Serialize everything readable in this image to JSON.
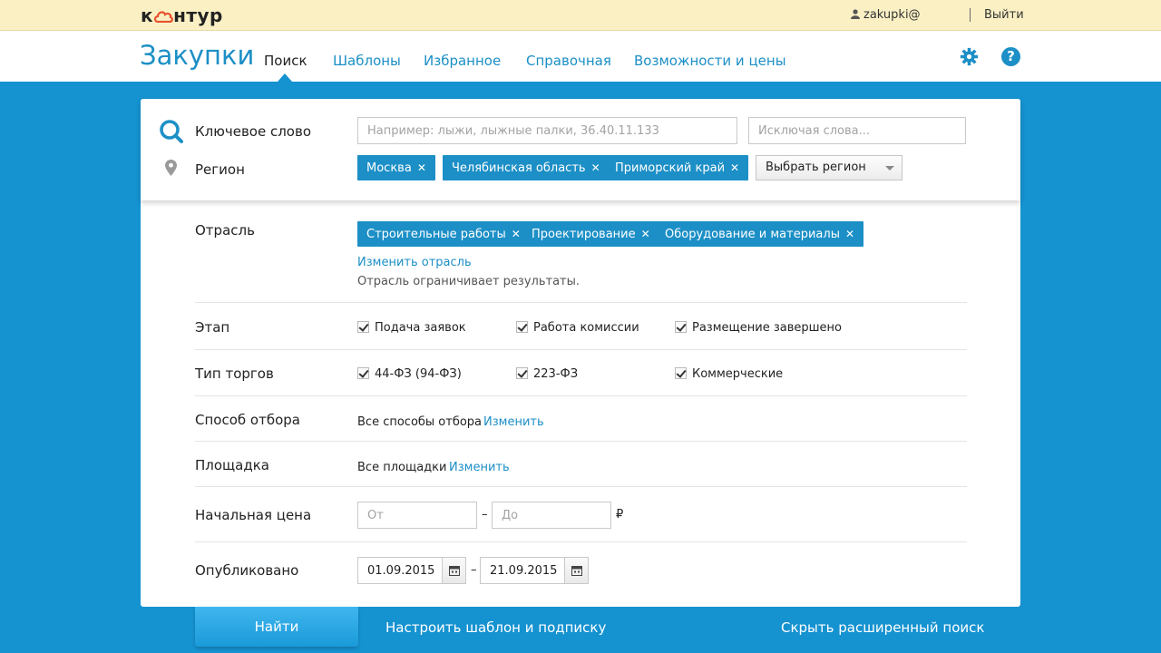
{
  "topbar": {
    "logo": {
      "part1": "к",
      "part2": "нтур"
    },
    "user": "zakupki@",
    "logout": "Выйти"
  },
  "header": {
    "brand": "Закупки",
    "nav": [
      {
        "label": "Поиск",
        "active": true
      },
      {
        "label": "Шаблоны"
      },
      {
        "label": "Избранное"
      },
      {
        "label": "Справочная"
      },
      {
        "label": "Возможности и цены"
      }
    ]
  },
  "search": {
    "keyword_label": "Ключевое слово",
    "keyword_placeholder": "Например: лыжи, лыжные палки, 36.40.11.133",
    "exclude_placeholder": "Исключая слова...",
    "region_label": "Регион",
    "regions": [
      "Москва",
      "Челябинская область",
      "Приморский край"
    ],
    "region_select": "Выбрать регион"
  },
  "filters": {
    "industry_label": "Отрасль",
    "industries": [
      "Строительные работы",
      "Проектирование",
      "Оборудование и материалы"
    ],
    "industry_change": "Изменить отрасль",
    "industry_note": "Отрасль ограничивает результаты.",
    "stage_label": "Этап",
    "stages": [
      "Подача заявок",
      "Работа комиссии",
      "Размещение завершено"
    ],
    "trade_label": "Тип торгов",
    "trades": [
      "44-ФЗ (94-ФЗ)",
      "223-ФЗ",
      "Коммерческие"
    ],
    "method_label": "Способ отбора",
    "method_value": "Все способы отбора",
    "method_change": "Изменить",
    "platform_label": "Площадка",
    "platform_value": "Все площадки",
    "platform_change": "Изменить",
    "price_label": "Начальная цена",
    "price_from_placeholder": "От",
    "price_to_placeholder": "До",
    "price_dash": "–",
    "currency": "₽",
    "published_label": "Опубликовано",
    "date_from": "01.09.2015",
    "date_to": "21.09.2015",
    "date_dash": "–"
  },
  "footer": {
    "find": "Найти",
    "template_link": "Настроить шаблон и подписку",
    "hide_link": "Скрыть расширенный поиск"
  },
  "colors": {
    "accent": "#1c8fc6",
    "background": "#1592d0",
    "topbar": "#fbf0c4",
    "logo_cloud": "#e8522d"
  }
}
